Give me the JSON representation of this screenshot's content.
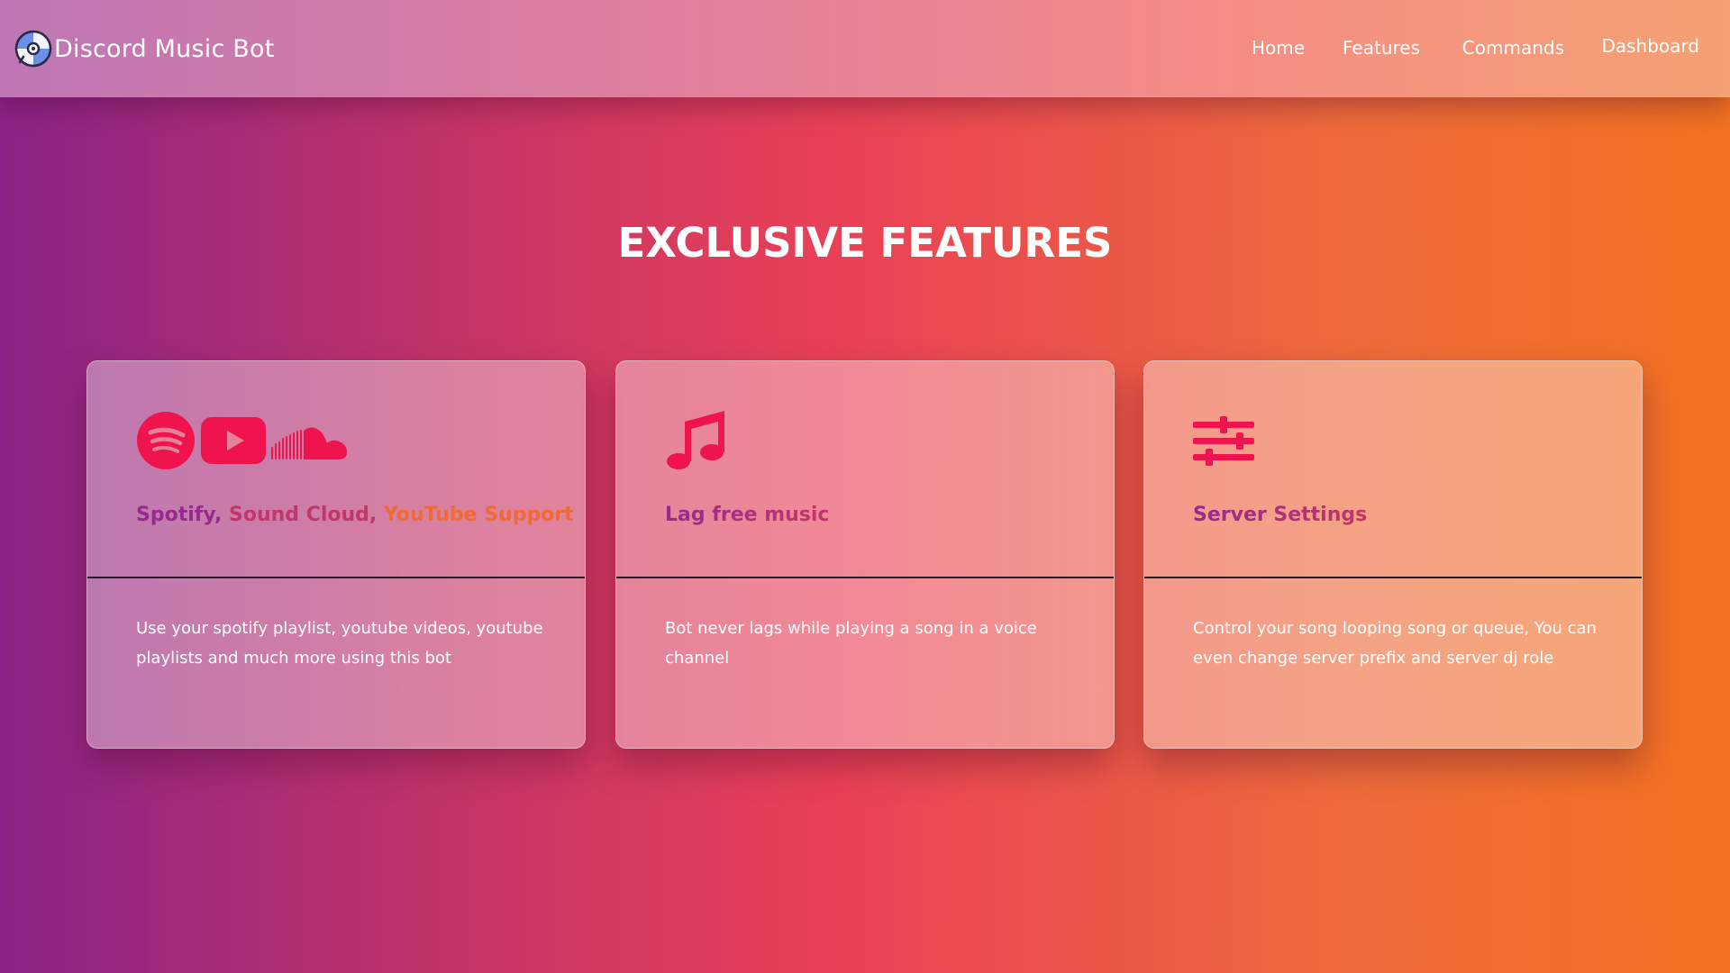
{
  "header": {
    "brand_title": "Discord Music Bot",
    "nav": [
      "Home",
      "Features",
      "Commands",
      "Dashboard"
    ]
  },
  "main": {
    "section_title": "EXCLUSIVE FEATURES",
    "cards": [
      {
        "heading_parts": [
          "Spotify, ",
          "Sound Cloud, ",
          "YouTube Support"
        ],
        "text": "Use your spotify playlist, youtube videos, youtube playlists and much more using this bot",
        "icons": [
          "spotify-icon",
          "youtube-icon",
          "soundcloud-icon"
        ]
      },
      {
        "heading": "Lag free music",
        "text": "Bot never lags while playing a song in a voice channel",
        "icons": [
          "music-note-icon"
        ]
      },
      {
        "heading": "Server Settings",
        "text": "Control your song looping song or queue, You can even change server prefix and server dj role",
        "icons": [
          "sliders-icon"
        ]
      }
    ]
  },
  "colors": {
    "icon": "#f0144e",
    "heading_purple": "#952b8e",
    "heading_pink": "#c33669",
    "heading_red": "#e0424f",
    "heading_orange": "#f06a33"
  }
}
